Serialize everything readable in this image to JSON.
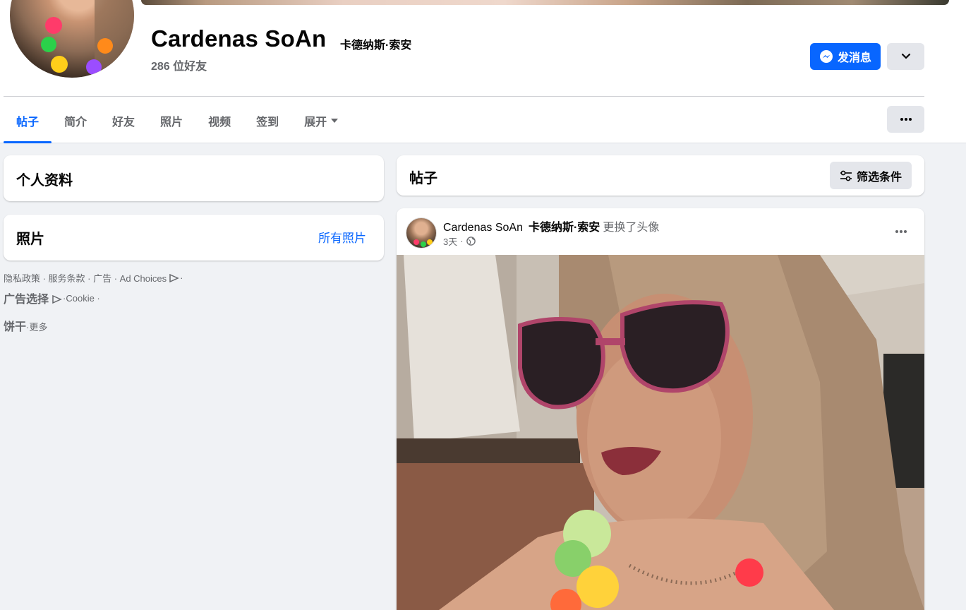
{
  "profile": {
    "name": "Cardenas SoAn",
    "alt_name": "卡德纳斯·索安",
    "friends": "286 位好友",
    "message_button": "发消息"
  },
  "tabs": [
    {
      "label": "帖子",
      "active": true
    },
    {
      "label": "简介"
    },
    {
      "label": "好友"
    },
    {
      "label": "照片"
    },
    {
      "label": "视频"
    },
    {
      "label": "签到"
    },
    {
      "label": "展开"
    }
  ],
  "left": {
    "profile_card_title": "个人资料",
    "photos_card_title": "照片",
    "all_photos_link": "所有照片"
  },
  "footer": {
    "line1": "隐私政策 · 服务条款 · 广告 · Ad Choices",
    "line1_end": " ·",
    "line2_big": "广告选择",
    "line2_rest": " ·Cookie ·",
    "line3_big": "饼干",
    "line3_rest": " ·更多"
  },
  "posts_section": {
    "title": "帖子",
    "filter_button": "筛选条件"
  },
  "post": {
    "author": "Cardenas SoAn",
    "author_alt": "卡德纳斯·索安",
    "action": "更换了头像",
    "time": "3天",
    "separator": "·",
    "privacy_icon": "globe-icon"
  },
  "colors": {
    "accent": "#0866ff",
    "background": "#f0f2f5",
    "secondary_text": "#65676b"
  }
}
